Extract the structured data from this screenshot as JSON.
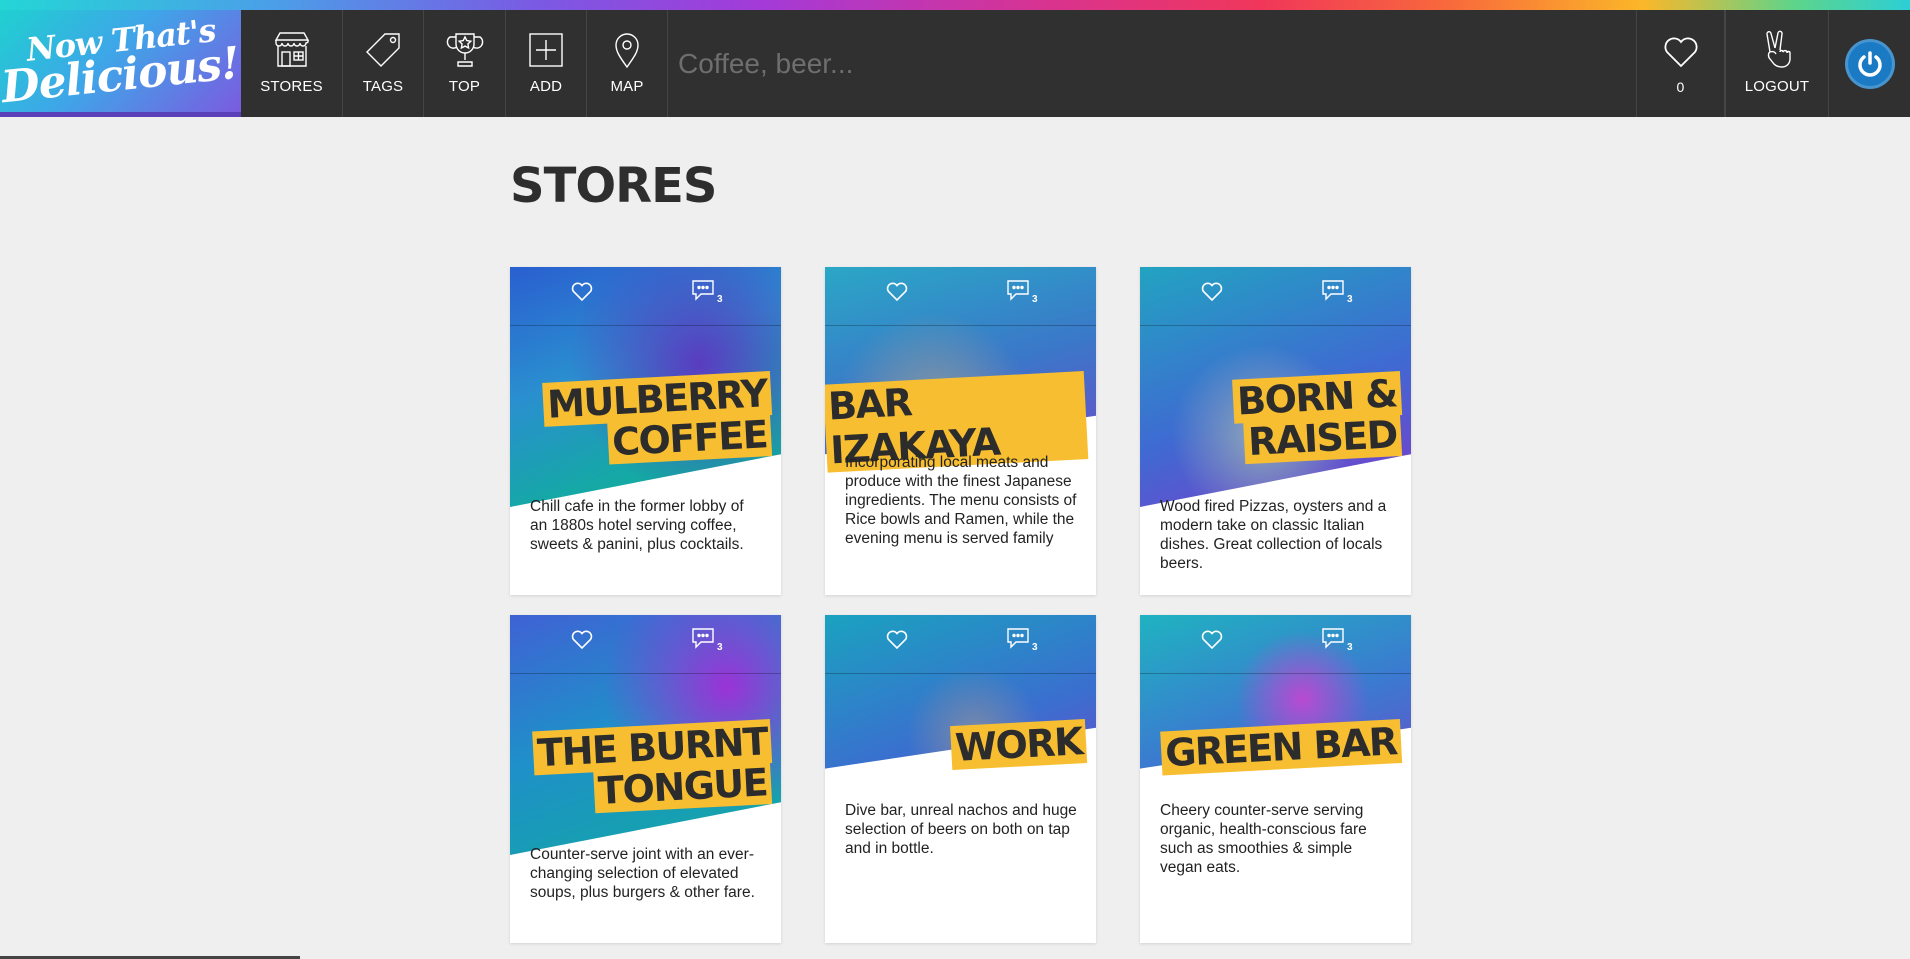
{
  "logo": {
    "line1": "Now That's",
    "line2": "Delicious!"
  },
  "nav": {
    "stores": "STORES",
    "tags": "TAGS",
    "top": "TOP",
    "add": "ADD",
    "map": "MAP",
    "hearts_count": "0",
    "logout": "LOGOUT"
  },
  "search": {
    "placeholder": "Coffee, beer..."
  },
  "page": {
    "title": "STORES"
  },
  "stores": [
    {
      "title_lines": [
        "MULBERRY",
        "COFFEE"
      ],
      "comments": "3",
      "description": "Chill cafe in the former lobby of an 1880s hotel serving coffee, sweets & panini, plus cocktails."
    },
    {
      "title_lines": [
        "BAR IZAKAYA"
      ],
      "comments": "3",
      "description": "Incorporating local meats and produce with the finest Japanese ingredients. The menu consists of Rice bowls and Ramen, while the evening menu is served family"
    },
    {
      "title_lines": [
        "BORN &",
        "RAISED"
      ],
      "comments": "3",
      "description": "Wood fired Pizzas, oysters and a modern take on classic Italian dishes. Great collection of locals beers."
    },
    {
      "title_lines": [
        "THE BURNT",
        "TONGUE"
      ],
      "comments": "3",
      "description": "Counter-serve joint with an ever-changing selection of elevated soups, plus burgers & other fare."
    },
    {
      "title_lines": [
        "WORK"
      ],
      "comments": "3",
      "description": "Dive bar, unreal nachos and huge selection of beers on both on tap and in bottle."
    },
    {
      "title_lines": [
        "GREEN BAR"
      ],
      "comments": "3",
      "description": "Cheery counter-serve serving organic, health-conscious fare such as smoothies & simple vegan eats."
    }
  ],
  "colors": {
    "navbar": "#303030",
    "accent_yellow": "#f7be31",
    "background": "#efefef",
    "avatar_blue": "#1a7ac4"
  },
  "icons": [
    "store-icon",
    "tag-icon",
    "trophy-icon",
    "add-icon",
    "map-pin-icon",
    "heart-icon",
    "peace-hand-icon",
    "power-icon",
    "comment-icon"
  ]
}
